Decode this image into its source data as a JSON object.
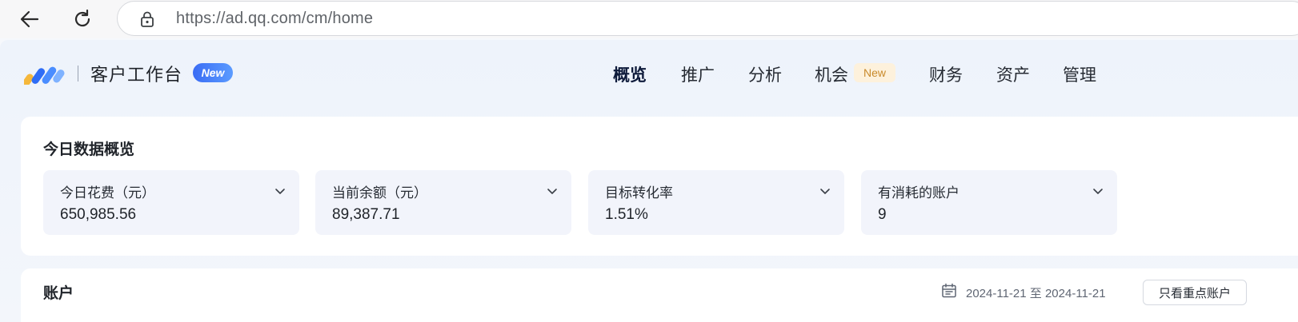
{
  "browser": {
    "url": "https://ad.qq.com/cm/home"
  },
  "brand": {
    "title": "客户工作台",
    "badge": "New"
  },
  "nav": {
    "items": [
      {
        "label": "概览",
        "active": true
      },
      {
        "label": "推广"
      },
      {
        "label": "分析"
      },
      {
        "label": "机会",
        "badge": "New"
      },
      {
        "label": "财务"
      },
      {
        "label": "资产"
      },
      {
        "label": "管理"
      }
    ]
  },
  "overview": {
    "title": "今日数据概览",
    "metrics": [
      {
        "label": "今日花费（元）",
        "value": "650,985.56"
      },
      {
        "label": "当前余额（元）",
        "value": "89,387.71"
      },
      {
        "label": "目标转化率",
        "value": "1.51%"
      },
      {
        "label": "有消耗的账户",
        "value": "9"
      }
    ]
  },
  "accounts": {
    "title": "账户",
    "date_range": "2024-11-21 至 2024-11-21",
    "key_accounts_button": "只看重点账户"
  },
  "icons": {
    "back": "arrow-left-icon",
    "reload": "reload-icon",
    "lock": "lock-icon",
    "logo": "brand-logo-icon",
    "chevron": "chevron-down-icon",
    "calendar": "calendar-icon"
  },
  "colors": {
    "accent": "#3a6cf4",
    "new_badge_bg": "#fdf1dc",
    "new_badge_text": "#c98a2b",
    "metric_bg": "#f2f4fb"
  }
}
